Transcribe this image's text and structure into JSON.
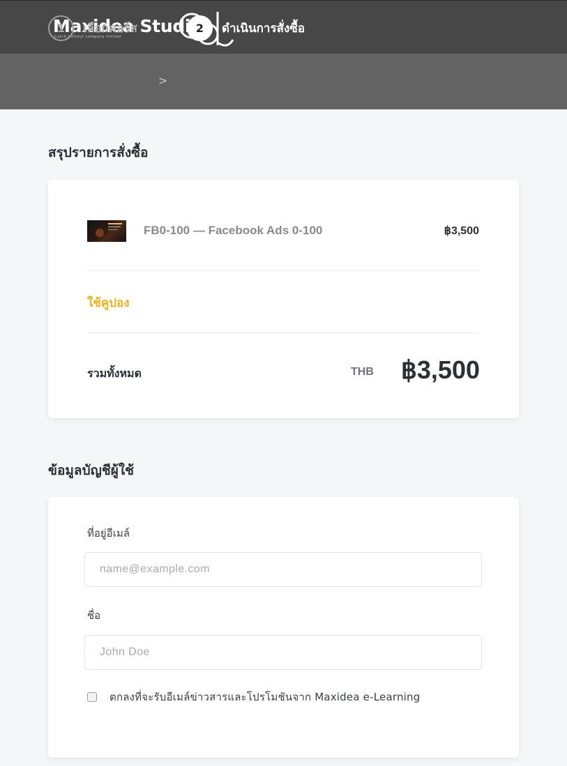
{
  "header": {
    "logo_text": "Maxidea Studi",
    "logo_tagline": "Catch without company limited"
  },
  "steps": [
    {
      "number": "1",
      "label": "เลือกคอร์ส",
      "active": false
    },
    {
      "number": "2",
      "label": "ดำเนินการสั่งซื้อ",
      "active": true
    }
  ],
  "step_separator": ">",
  "order_summary": {
    "title": "สรุปรายการสั่งซื้อ",
    "item": {
      "name": "FB0-100 — Facebook Ads 0-100",
      "price": "฿3,500"
    },
    "coupon_link": "ใช้คูปอง",
    "total_label": "รวมทั้งหมด",
    "currency": "THB",
    "total_amount": "฿3,500"
  },
  "account_info": {
    "title": "ข้อมูลบัญชีผู้ใช้",
    "email": {
      "label": "ที่อยู่อีเมล์",
      "placeholder": "name@example.com",
      "value": ""
    },
    "name": {
      "label": "ชื่อ",
      "placeholder": "John Doe",
      "value": ""
    },
    "newsletter": {
      "label": "ตกลงที่จะรับอีเมล์ข่าวสารและโปรโมชันจาก Maxidea e-Learning",
      "checked": false
    }
  },
  "colors": {
    "topbar": "#474747",
    "stepbar": "#636363",
    "accent": "#f0b21a",
    "background": "#f4f6f8"
  }
}
